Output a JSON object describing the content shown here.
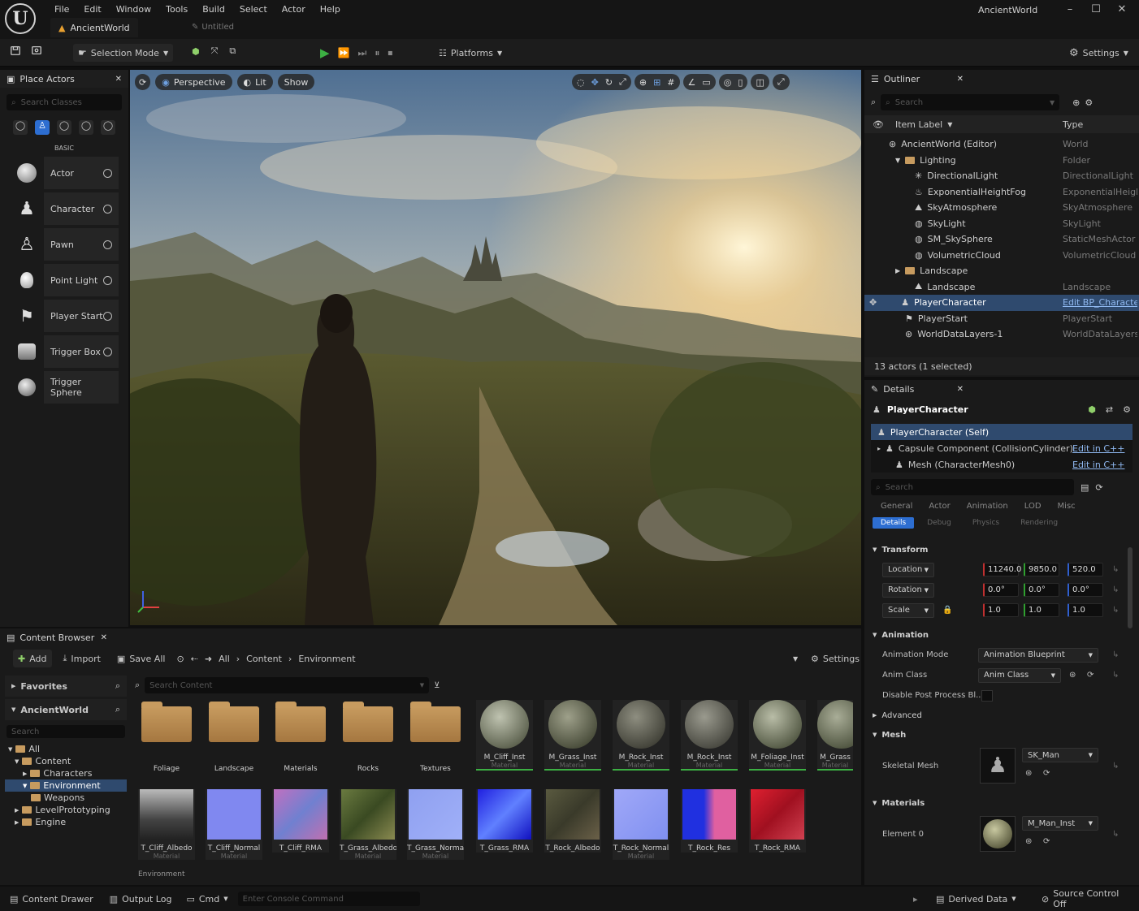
{
  "window": {
    "title": "AncientWorld",
    "project_tab": "AncientWorld",
    "second_tab": "Untitled"
  },
  "menu": [
    "File",
    "Edit",
    "Window",
    "Tools",
    "Build",
    "Select",
    "Actor",
    "Help"
  ],
  "toolbar": {
    "mode_label": "Selection Mode",
    "platforms_label": "Platforms",
    "settings_label": "Settings"
  },
  "place_actors": {
    "title": "Place Actors",
    "search_placeholder": "Search Classes",
    "category": "BASIC",
    "items": [
      {
        "label": "Actor",
        "icon": "actor-icon"
      },
      {
        "label": "Character",
        "icon": "character-icon"
      },
      {
        "label": "Pawn",
        "icon": "pawn-icon"
      },
      {
        "label": "Point Light",
        "icon": "point-light-icon"
      },
      {
        "label": "Player Start",
        "icon": "player-start-icon"
      },
      {
        "label": "Trigger Box",
        "icon": "trigger-box-icon"
      },
      {
        "label": "Trigger Sphere",
        "icon": "trigger-sphere-icon"
      }
    ]
  },
  "viewport": {
    "perspective_label": "Perspective",
    "lit_label": "Lit",
    "show_label": "Show"
  },
  "outliner": {
    "title": "Outliner",
    "search_placeholder": "Search",
    "col_label": "Item Label",
    "col_type": "Type",
    "rows": [
      {
        "label": "AncientWorld (Editor)",
        "type": "World"
      },
      {
        "label": "Lighting",
        "type": "Folder"
      },
      {
        "label": "DirectionalLight",
        "type": "DirectionalLight"
      },
      {
        "label": "ExponentialHeightFog",
        "type": "ExponentialHeight"
      },
      {
        "label": "SkyAtmosphere",
        "type": "SkyAtmosphere"
      },
      {
        "label": "SkyLight",
        "type": "SkyLight"
      },
      {
        "label": "SM_SkySphere",
        "type": "StaticMeshActor"
      },
      {
        "label": "VolumetricCloud",
        "type": "VolumetricCloud"
      },
      {
        "label": "Landscape",
        "type": ""
      },
      {
        "label": "Landscape",
        "type": "Landscape"
      },
      {
        "label": "PlayerCharacter",
        "type": "Edit BP_Character"
      },
      {
        "label": "PlayerStart",
        "type": "PlayerStart"
      },
      {
        "label": "WorldDataLayers-1",
        "type": "WorldDataLayers"
      }
    ],
    "footer": "13 actors (1 selected)"
  },
  "details": {
    "title": "Details",
    "actor_name": "PlayerCharacter",
    "components": [
      {
        "label": "PlayerCharacter (Self)",
        "link": ""
      },
      {
        "label": "Capsule Component (CollisionCylinder)",
        "link": "Edit in C++"
      },
      {
        "label": "Mesh (CharacterMesh0)",
        "link": "Edit in C++"
      }
    ],
    "search_placeholder": "Search",
    "filter_tabs": [
      "General",
      "Actor",
      "Animation",
      "LOD",
      "Misc"
    ],
    "filter_tabs2": [
      "Details",
      "Debug",
      "Physics",
      "Rendering"
    ],
    "transform": {
      "section": "Transform",
      "location_label": "Location",
      "location": [
        "11240.0",
        "9850.0",
        "520.0"
      ],
      "rotation_label": "Rotation",
      "rotation": [
        "0.0°",
        "0.0°",
        "0.0°"
      ],
      "scale_label": "Scale",
      "scale": [
        "1.0",
        "1.0",
        "1.0"
      ]
    },
    "animation": {
      "section": "Animation",
      "mode_label": "Animation Mode",
      "mode_value": "Animation Blueprint",
      "class_label": "Anim Class",
      "class_value": "Anim Class",
      "disable_label": "Disable Post Process Bl..."
    },
    "advanced_section": "Advanced",
    "mesh": {
      "section": "Mesh",
      "label": "Skeletal Mesh",
      "value": "SK_Man"
    },
    "materials": {
      "section": "Materials",
      "label": "Element 0",
      "value": "M_Man_Inst"
    }
  },
  "content_browser": {
    "title": "Content Browser",
    "add_label": "Add",
    "import_label": "Import",
    "save_all_label": "Save All",
    "settings_label": "Settings",
    "breadcrumb": [
      "All",
      "Content",
      "Environment"
    ],
    "search_placeholder": "Search Content",
    "favorites_label": "Favorites",
    "project_label": "AncientWorld",
    "tree_search_placeholder": "Search",
    "tree": [
      {
        "label": "All",
        "depth": 0
      },
      {
        "label": "Content",
        "depth": 1
      },
      {
        "label": "Characters",
        "depth": 2
      },
      {
        "label": "Environment",
        "depth": 2
      },
      {
        "label": "Weapons",
        "depth": 2
      },
      {
        "label": "LevelPrototyping",
        "depth": 1
      },
      {
        "label": "Engine",
        "depth": 1
      }
    ],
    "folders": [
      "Foliage",
      "Landscape",
      "Materials",
      "Rocks",
      "Textures"
    ],
    "materials": [
      {
        "name": "M_Cliff_Inst",
        "sub": "Material"
      },
      {
        "name": "M_Grass_Inst",
        "sub": "Material"
      },
      {
        "name": "M_Rock_Inst",
        "sub": "Material"
      },
      {
        "name": "M_Rock_Inst",
        "sub": "Material"
      },
      {
        "name": "M_Foliage_Inst",
        "sub": "Material"
      },
      {
        "name": "M_Grass",
        "sub": "Material"
      }
    ],
    "textures": [
      {
        "name": "T_Cliff_Albedo",
        "sub": "Material"
      },
      {
        "name": "T_Cliff_Normal",
        "sub": "Material"
      },
      {
        "name": "T_Cliff_RMA",
        "sub": ""
      },
      {
        "name": "T_Grass_Albedo",
        "sub": "Material"
      },
      {
        "name": "T_Grass_Normal",
        "sub": "Material"
      },
      {
        "name": "T_Grass_RMA",
        "sub": ""
      },
      {
        "name": "T_Rock_Albedo",
        "sub": ""
      },
      {
        "name": "T_Rock_Normal",
        "sub": "Material"
      },
      {
        "name": "T_Rock_Res",
        "sub": ""
      },
      {
        "name": "T_Rock_RMA",
        "sub": ""
      }
    ],
    "status": "Environment"
  },
  "statusbar": {
    "content_drawer": "Content Drawer",
    "output_log": "Output Log",
    "cmd": "Cmd",
    "console_placeholder": "Enter Console Command",
    "derived_data": "Derived Data",
    "source_control": "Source Control Off"
  },
  "colors": {
    "accent_blue": "#2d6ed1",
    "selection": "#2f4a6e",
    "play_green": "#3cb043",
    "folder": "#c79b5f"
  }
}
